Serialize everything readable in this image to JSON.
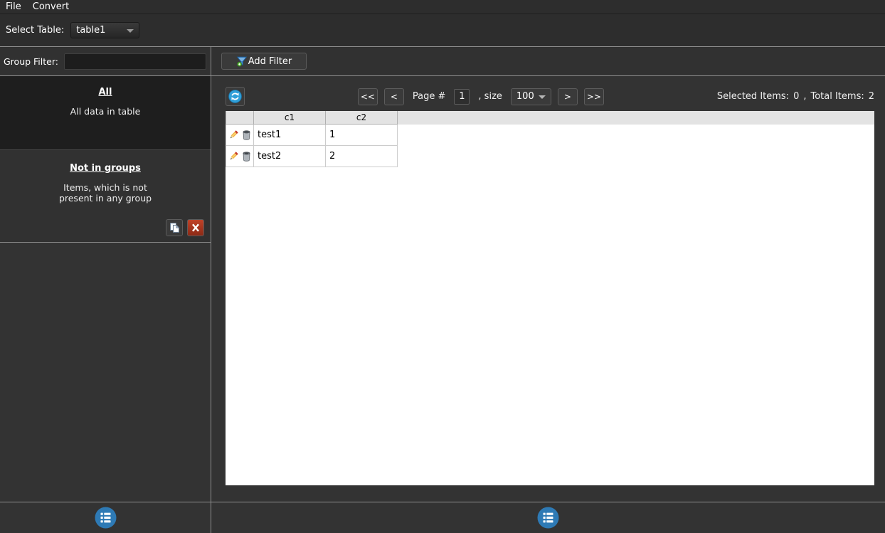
{
  "menu": {
    "items": [
      {
        "label": "File"
      },
      {
        "label": "Convert"
      }
    ]
  },
  "table_selector": {
    "label": "Select Table:",
    "value": "table1"
  },
  "sidebar": {
    "group_filter_label": "Group Filter:",
    "group_filter_value": "",
    "group_all": {
      "title": "All",
      "description": "All data in table"
    },
    "group_notin": {
      "title": "Not in groups",
      "description_line1": "Items, which is not",
      "description_line2": "present in any group"
    }
  },
  "toolbar": {
    "add_filter_label": "Add Filter"
  },
  "pagination": {
    "first_label": "<<",
    "prev_label": "<",
    "page_label": "Page #",
    "page_value": "1",
    "size_label": ", size",
    "size_value": "100",
    "next_label": ">",
    "last_label": ">>",
    "selected_items_label": "Selected Items:",
    "selected_items": "0",
    "separator": ",",
    "total_items_label": "Total Items:",
    "total_items": "2"
  },
  "table": {
    "columns": [
      "c1",
      "c2"
    ],
    "rows": [
      {
        "c1": "test1",
        "c2": "1"
      },
      {
        "c1": "test2",
        "c2": "2"
      }
    ]
  },
  "colors": {
    "accent_blue": "#2e7ab5",
    "refresh_blue": "#2f9fd8",
    "funnel_blue": "#3d85c8",
    "badge_green": "#58b636",
    "delete_red": "#b03020",
    "table_header_bg": "#e3e3e3",
    "panel_bg": "#ffffff",
    "app_bg": "#333333"
  }
}
